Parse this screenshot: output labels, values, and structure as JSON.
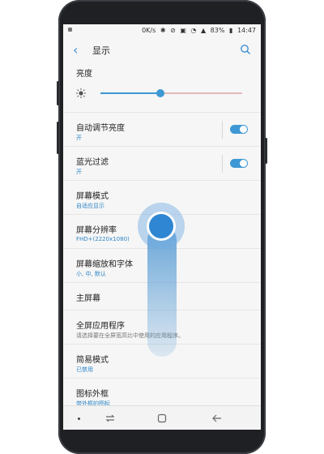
{
  "status_bar": {
    "speed": "0K/s",
    "battery": "83%",
    "time": "14:47"
  },
  "header": {
    "back_icon": "back-chevron-icon",
    "title": "显示",
    "search_icon": "search-icon"
  },
  "brightness": {
    "title": "亮度",
    "level": 0.42
  },
  "settings": [
    {
      "label": "自动调节亮度",
      "sub": "开",
      "toggle": true
    },
    {
      "label": "蓝光过滤",
      "sub": "开",
      "toggle": true
    },
    {
      "label": "屏幕模式",
      "sub": "自适应显示"
    },
    {
      "label": "屏幕分辨率",
      "sub": "FHD+(2220x1080)"
    },
    {
      "label": "屏幕缩放和字体",
      "sub": "小, 中, 默认"
    },
    {
      "label": "主屏幕",
      "sub": ""
    },
    {
      "label": "全屏应用程序",
      "sub": "请选择要在全屏宽高比中使用的应用程序。"
    },
    {
      "label": "简易模式",
      "sub": "已禁用"
    },
    {
      "label": "图标外框",
      "sub": "带外框的图标"
    }
  ],
  "nav": {
    "recents_icon": "recents-icon",
    "home_icon": "home-icon",
    "back_icon": "back-arrow-icon"
  },
  "colors": {
    "accent": "#3e98d4",
    "sub_text": "#2f86c7"
  }
}
